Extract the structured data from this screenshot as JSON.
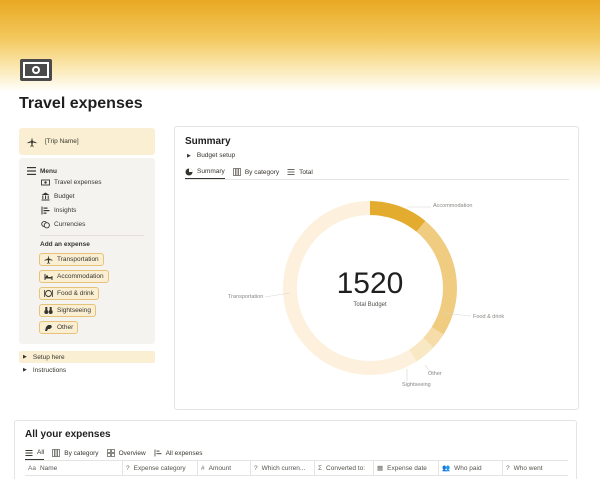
{
  "page": {
    "title": "Travel expenses",
    "icon": "money-bill-icon"
  },
  "colors": {
    "accent": "#e3ac2f",
    "chip_bg": "#fbefd3",
    "panel_bg": "#f5f3ef"
  },
  "sidebar": {
    "trip_name": "[Trip Name]",
    "menu_label": "Menu",
    "menu_items": [
      {
        "label": "Travel expenses",
        "icon": "money-icon"
      },
      {
        "label": "Budget",
        "icon": "bank-icon"
      },
      {
        "label": "Insights",
        "icon": "chart-icon"
      },
      {
        "label": "Currencies",
        "icon": "coins-icon"
      }
    ],
    "add_label": "Add an expense",
    "add_items": [
      {
        "label": "Transportation",
        "icon": "plane-icon"
      },
      {
        "label": "Accommodation",
        "icon": "bed-icon"
      },
      {
        "label": "Food & drink",
        "icon": "food-icon"
      },
      {
        "label": "Sightseeing",
        "icon": "binoculars-icon"
      },
      {
        "label": "Other",
        "icon": "other-icon"
      }
    ],
    "toggles": [
      {
        "label": "Setup here"
      },
      {
        "label": "Instructions"
      }
    ]
  },
  "summary": {
    "title": "Summary",
    "budget_toggle": "Budget setup",
    "tabs": [
      {
        "label": "Summary"
      },
      {
        "label": "By category"
      },
      {
        "label": "Total"
      }
    ],
    "total_value": "1520",
    "total_label": "Total Budget"
  },
  "chart_data": {
    "type": "pie",
    "categories": [
      "Accommodation",
      "Food & drink",
      "Other",
      "Sightseeing",
      "Transportation"
    ],
    "values": [
      0.11,
      0.23,
      0.03,
      0.04,
      0.59
    ],
    "colors": [
      "#e3ac2f",
      "#efcc80",
      "#f5dca8",
      "#f9e8c4",
      "#fdf1de"
    ],
    "donut": true
  },
  "expenses": {
    "title": "All your expenses",
    "tabs": [
      {
        "label": "All"
      },
      {
        "label": "By category"
      },
      {
        "label": "Overview"
      },
      {
        "label": "All expenses"
      }
    ],
    "columns": [
      {
        "label": "Name",
        "icon": "Aa"
      },
      {
        "label": "Expense category",
        "icon": "?"
      },
      {
        "label": "Amount",
        "icon": "#"
      },
      {
        "label": "Which curren...",
        "icon": "?"
      },
      {
        "label": "Converted to:",
        "icon": "Σ"
      },
      {
        "label": "Expense date",
        "icon": "▦"
      },
      {
        "label": "Who paid",
        "icon": "👥"
      },
      {
        "label": "Who went",
        "icon": "?"
      }
    ]
  }
}
